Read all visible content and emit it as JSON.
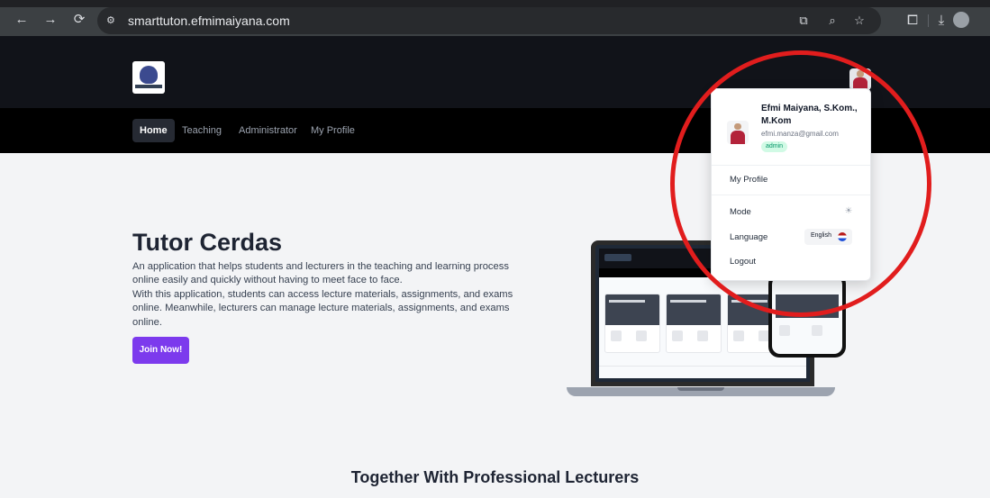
{
  "browser": {
    "url": "smarttuton.efmimaiyana.com",
    "icons": [
      "back-arrow-icon",
      "forward-arrow-icon",
      "reload-icon",
      "site-info-icon",
      "translate-icon",
      "zoom-icon",
      "bookmark-star-icon",
      "extensions-icon",
      "download-icon",
      "profile-icon"
    ]
  },
  "nav": {
    "items": [
      {
        "label": "Home",
        "active": true
      },
      {
        "label": "Teaching",
        "active": false
      },
      {
        "label": "Administrator",
        "active": false
      },
      {
        "label": "My Profile",
        "active": false
      }
    ]
  },
  "hero": {
    "title": "Tutor Cerdas",
    "description": "An application that helps students and lecturers in the teaching and learning process online easily and quickly without having to meet face to face.",
    "description2": "With this application, students can access lecture materials, assignments, and exams online. Meanwhile, lecturers can manage lecture materials, assignments, and exams online.",
    "cta": "Join Now!"
  },
  "dropdown": {
    "user_name": "Efmi Maiyana, S.Kom., M.Kom",
    "email": "efmi.manza@gmail.com",
    "role": "admin",
    "my_profile": "My Profile",
    "mode": "Mode",
    "language": "Language",
    "language_value": "English",
    "logout": "Logout"
  },
  "section": {
    "title": "Together With Professional Lecturers"
  },
  "colors": {
    "accent": "#7c3aed",
    "header_bg": "#111319",
    "annotation": "#e11d1d",
    "badge": "#059669"
  }
}
